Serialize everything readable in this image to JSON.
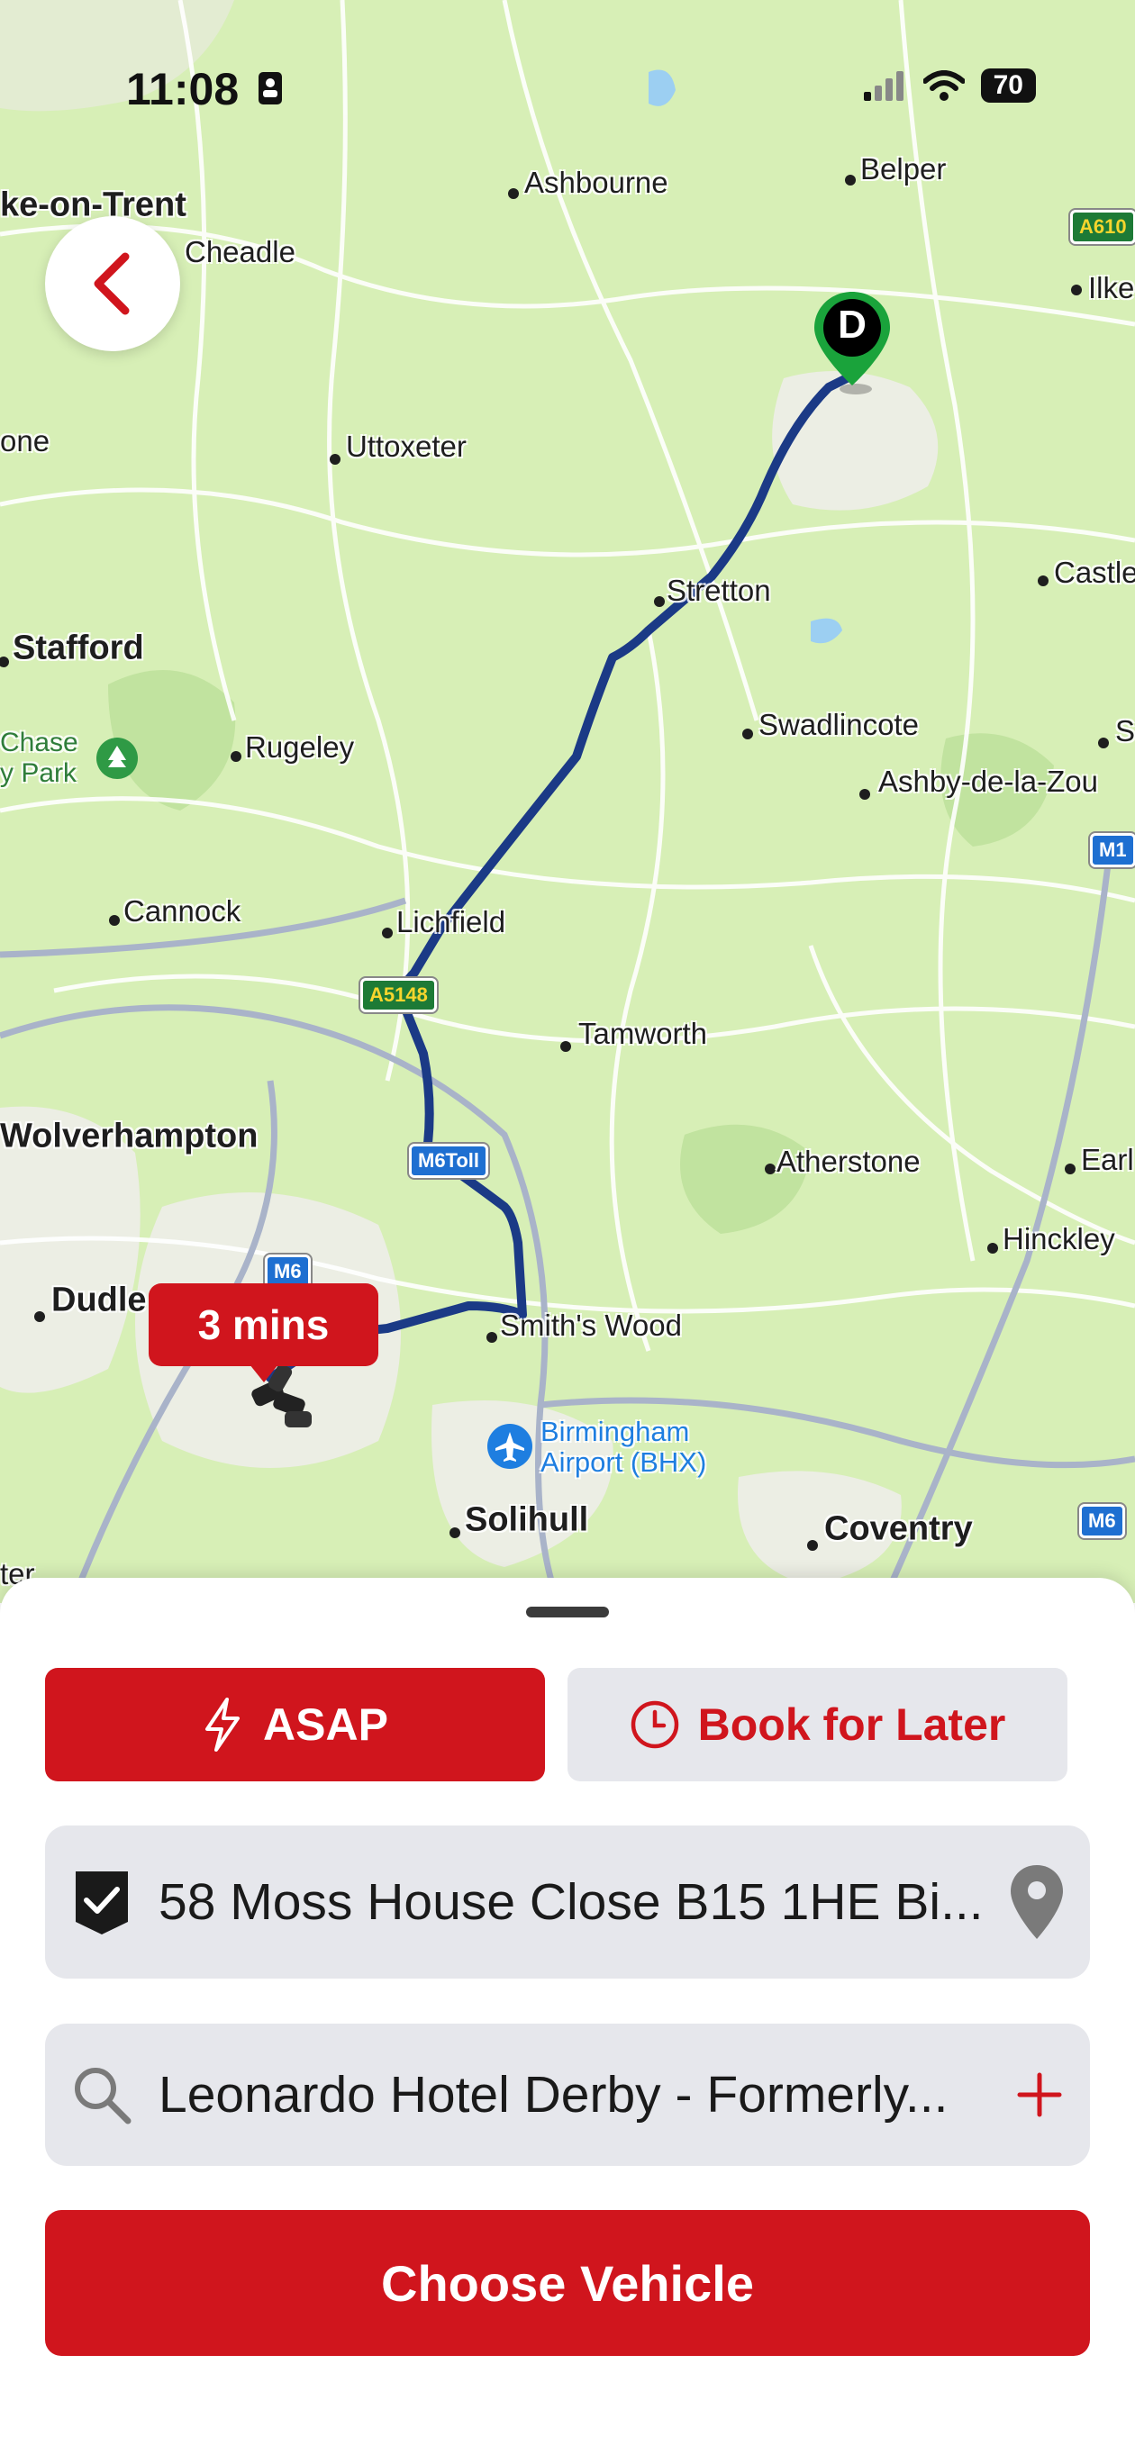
{
  "status_bar": {
    "time": "11:08",
    "battery": "70"
  },
  "map": {
    "eta_label": "3 mins",
    "destination_marker": "D",
    "places": {
      "stoke": "ke-on-Trent",
      "cheadle": "Cheadle",
      "ashbourne": "Ashbourne",
      "belper": "Belper",
      "ilke": "Ilke",
      "one": "one",
      "uttoxeter": "Uttoxeter",
      "castle": "Castle",
      "stretton": "Stretton",
      "stafford": "Stafford",
      "swadlincote": "Swadlincote",
      "s": "S",
      "chase_park": "Chase\ny Park",
      "rugeley": "Rugeley",
      "ashby": "Ashby-de-la-Zou",
      "cannock": "Cannock",
      "lichfield": "Lichfield",
      "tamworth": "Tamworth",
      "wolverhampton": "Wolverhampton",
      "atherstone": "Atherstone",
      "earl": "Earl",
      "hinckley": "Hinckley",
      "dudley": "Dudle",
      "smiths_wood": "Smith's Wood",
      "airport": "Birmingham\nAirport (BHX)",
      "solihull": "Solihull",
      "coventry": "Coventry",
      "ter": "ter"
    },
    "road_shields": {
      "a610": "A610",
      "a5148": "A5148",
      "m6toll": "M6Toll",
      "m6_west": "M6",
      "m6_east": "M6",
      "m1": "M1"
    }
  },
  "booking": {
    "asap_label": "ASAP",
    "book_later_label": "Book for Later",
    "pickup_address": "58 Moss House Close B15 1HE Bi...",
    "dropoff_value": "Leonardo Hotel Derby - Formerly...",
    "choose_vehicle_label": "Choose Vehicle"
  },
  "colors": {
    "brand_red": "#d0151d",
    "route_blue": "#1b3a86",
    "field_gray": "#e6e7ec"
  },
  "icons": {
    "back": "chevron-left-icon",
    "asap": "lightning-icon",
    "later": "clock-icon",
    "pickup": "shield-check-icon",
    "pickup_action": "location-pin-icon",
    "dropoff": "search-icon",
    "dropoff_action": "plus-icon"
  }
}
